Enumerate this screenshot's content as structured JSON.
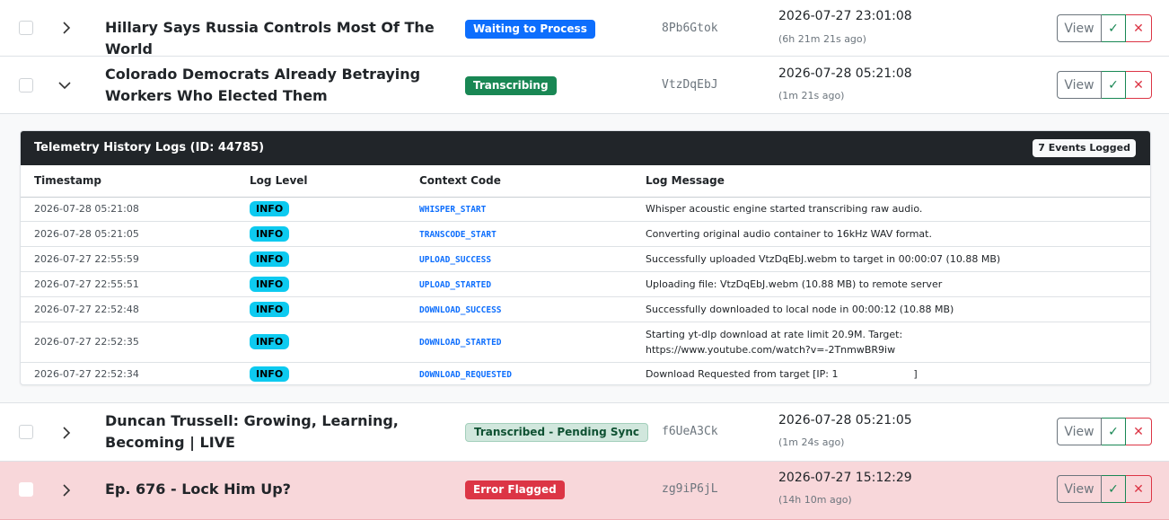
{
  "rows": [
    {
      "title": "Hillary Says Russia Controls Most Of The World",
      "status": "Waiting to Process",
      "hash": "8Pb6Gtok",
      "timestamp": "2026-07-27 23:01:08",
      "ago": "(6h 21m 21s ago)",
      "expanded": false
    },
    {
      "title": "Colorado Democrats Already Betraying Workers Who Elected Them",
      "status": "Transcribing",
      "hash": "VtzDqEbJ",
      "timestamp": "2026-07-28 05:21:08",
      "ago": "(1m 21s ago)",
      "expanded": true
    },
    {
      "title": "Duncan Trussell: Growing, Learning, Becoming | LIVE",
      "status": "Transcribed - Pending Sync",
      "hash": "f6UeA3Ck",
      "timestamp": "2026-07-28 05:21:05",
      "ago": "(1m 24s ago)",
      "expanded": false
    },
    {
      "title": "Ep. 676 - Lock Him Up?",
      "status": "Error Flagged",
      "hash": "zg9iP6jL",
      "timestamp": "2026-07-27 15:12:29",
      "ago": "(14h 10m ago)",
      "expanded": false
    }
  ],
  "actions": {
    "view_label": "View",
    "approve_glyph": "✓",
    "reject_glyph": "✕"
  },
  "telemetry": {
    "title": "Telemetry History Logs (ID: 44785)",
    "count_label": "7 Events Logged",
    "columns": [
      "Timestamp",
      "Log Level",
      "Context Code",
      "Log Message"
    ],
    "logs": [
      {
        "ts": "2026-07-28 05:21:08",
        "level": "INFO",
        "code": "WHISPER_START",
        "msg": "Whisper acoustic engine started transcribing raw audio."
      },
      {
        "ts": "2026-07-28 05:21:05",
        "level": "INFO",
        "code": "TRANSCODE_START",
        "msg": "Converting original audio container to 16kHz WAV format."
      },
      {
        "ts": "2026-07-27 22:55:59",
        "level": "INFO",
        "code": "UPLOAD_SUCCESS",
        "msg": "Successfully uploaded VtzDqEbJ.webm to target in 00:00:07 (10.88 MB)"
      },
      {
        "ts": "2026-07-27 22:55:51",
        "level": "INFO",
        "code": "UPLOAD_STARTED",
        "msg": "Uploading file: VtzDqEbJ.webm (10.88 MB) to remote server"
      },
      {
        "ts": "2026-07-27 22:52:48",
        "level": "INFO",
        "code": "DOWNLOAD_SUCCESS",
        "msg": "Successfully downloaded to local node in 00:00:12 (10.88 MB)"
      },
      {
        "ts": "2026-07-27 22:52:35",
        "level": "INFO",
        "code": "DOWNLOAD_STARTED",
        "msg": "Starting yt-dlp download at rate limit 20.9M. Target: https://www.youtube.com/watch?v=-2TnmwBR9iw"
      },
      {
        "ts": "2026-07-27 22:52:34",
        "level": "INFO",
        "code": "DOWNLOAD_REQUESTED",
        "msg": "Download Requested from target [IP: 1                        ]"
      }
    ]
  },
  "colors": {
    "waiting": "#0d6efd",
    "transcribing": "#198754",
    "pending_sync_bg": "#d1e7dd",
    "error": "#dc3545",
    "error_row_bg": "#f8d7da",
    "info": "#0dcaf0",
    "panel_header": "#212529"
  }
}
